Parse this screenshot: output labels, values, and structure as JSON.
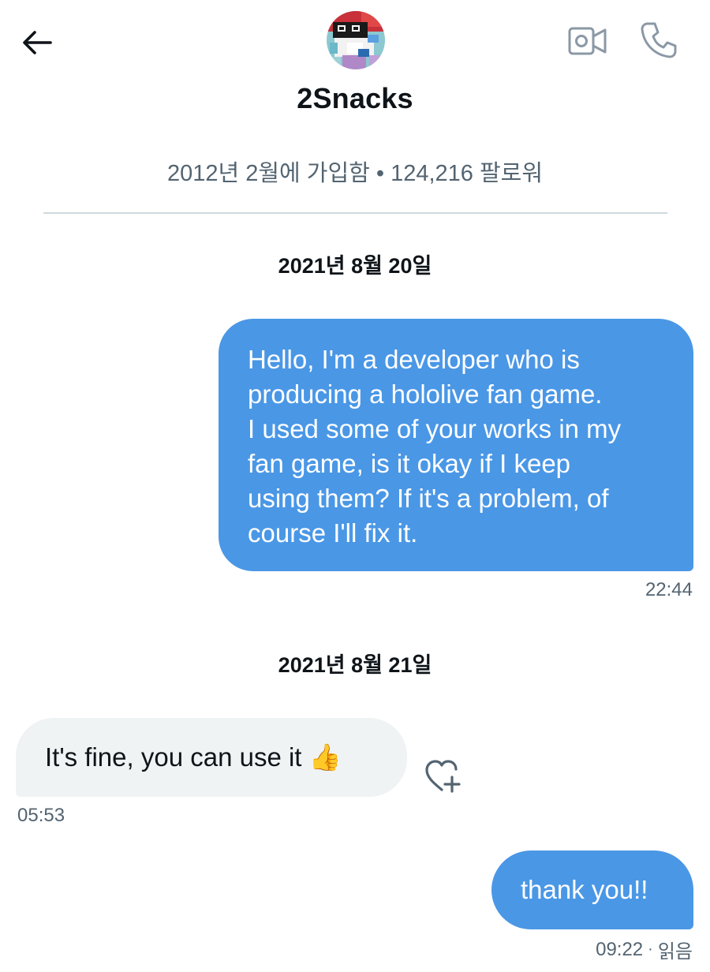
{
  "header": {
    "name": "2Snacks",
    "back_icon": "arrow-left-icon",
    "video_icon": "video-camera-icon",
    "call_icon": "phone-icon"
  },
  "profile": {
    "meta": "2012년 2월에 가입함 • 124,216 팔로워"
  },
  "conversation": {
    "groups": [
      {
        "date": "2021년 8월 20일",
        "messages": [
          {
            "direction": "outgoing",
            "lines": [
              "Hello, I'm a developer who is",
              "producing a hololive fan game.",
              "I used some of your works in my",
              "fan game, is it okay if I keep",
              "using them? If it's a problem, of",
              "course I'll fix it."
            ],
            "time": "22:44"
          }
        ]
      },
      {
        "date": "2021년 8월 21일",
        "messages": [
          {
            "direction": "incoming",
            "text": "It's fine, you can use it 👍",
            "time": "05:53"
          },
          {
            "direction": "outgoing",
            "text": "thank you!!",
            "time": "09:22",
            "status": "읽음"
          }
        ]
      }
    ]
  },
  "colors": {
    "outgoing_bubble": "#4a97e6",
    "incoming_bubble": "#eff3f4",
    "secondary_text": "#536471",
    "primary_text": "#0f1419"
  },
  "icons": {
    "reaction": "heart-plus-icon",
    "avatar": "pixel-art-avatar"
  }
}
